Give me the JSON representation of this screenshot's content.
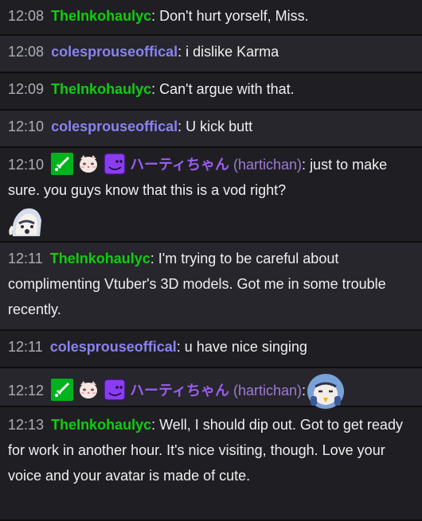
{
  "messages": [
    {
      "time": "12:08",
      "user": "TheInkohaulyc",
      "color": "#11cc11",
      "sep": ": ",
      "text": "Don't hurt yorself, Miss."
    },
    {
      "time": "12:08",
      "user": "colesprouseoffical",
      "color": "#8a82f0",
      "sep": ": ",
      "text": "i dislike Karma"
    },
    {
      "time": "12:09",
      "user": "TheInkohaulyc",
      "color": "#11cc11",
      "sep": ": ",
      "text": "Can't argue with that."
    },
    {
      "time": "12:10",
      "user": "colesprouseoffical",
      "color": "#8a82f0",
      "sep": ": ",
      "text": "U kick butt"
    },
    {
      "time": "12:10",
      "badges": [
        "sword-badge-icon",
        "cat-face-badge-icon",
        "purple-blob-badge-icon"
      ],
      "user": "ハーティちゃん",
      "sub": "(hartichan)",
      "color": "#9b5ef0",
      "sep": ": ",
      "text": "just to make sure. you guys know that this is a vod right?",
      "emote": "hooded-chibi-emote-icon"
    },
    {
      "time": "12:11",
      "user": "TheInkohaulyc",
      "color": "#11cc11",
      "sep": ": ",
      "text": "I'm trying to be careful about complimenting Vtuber's 3D models. Got me in some trouble recently."
    },
    {
      "time": "12:11",
      "user": "colesprouseoffical",
      "color": "#8a82f0",
      "sep": ": ",
      "text": "u have nice singing"
    },
    {
      "time": "12:12",
      "badges": [
        "sword-badge-icon",
        "cat-face-badge-icon",
        "purple-blob-badge-icon"
      ],
      "user": "ハーティちゃん",
      "sub": "(hartichan)",
      "color": "#9b5ef0",
      "sep": ":",
      "text": "",
      "emote": "thinking-chibi-emote-icon"
    },
    {
      "time": "12:13",
      "user": "TheInkohaulyc",
      "color": "#11cc11",
      "sep": ": ",
      "text": "Well, I should dip out. Got to get ready for work in another hour. It's nice visiting, though. Love your voice and your avatar is made of cute."
    }
  ]
}
